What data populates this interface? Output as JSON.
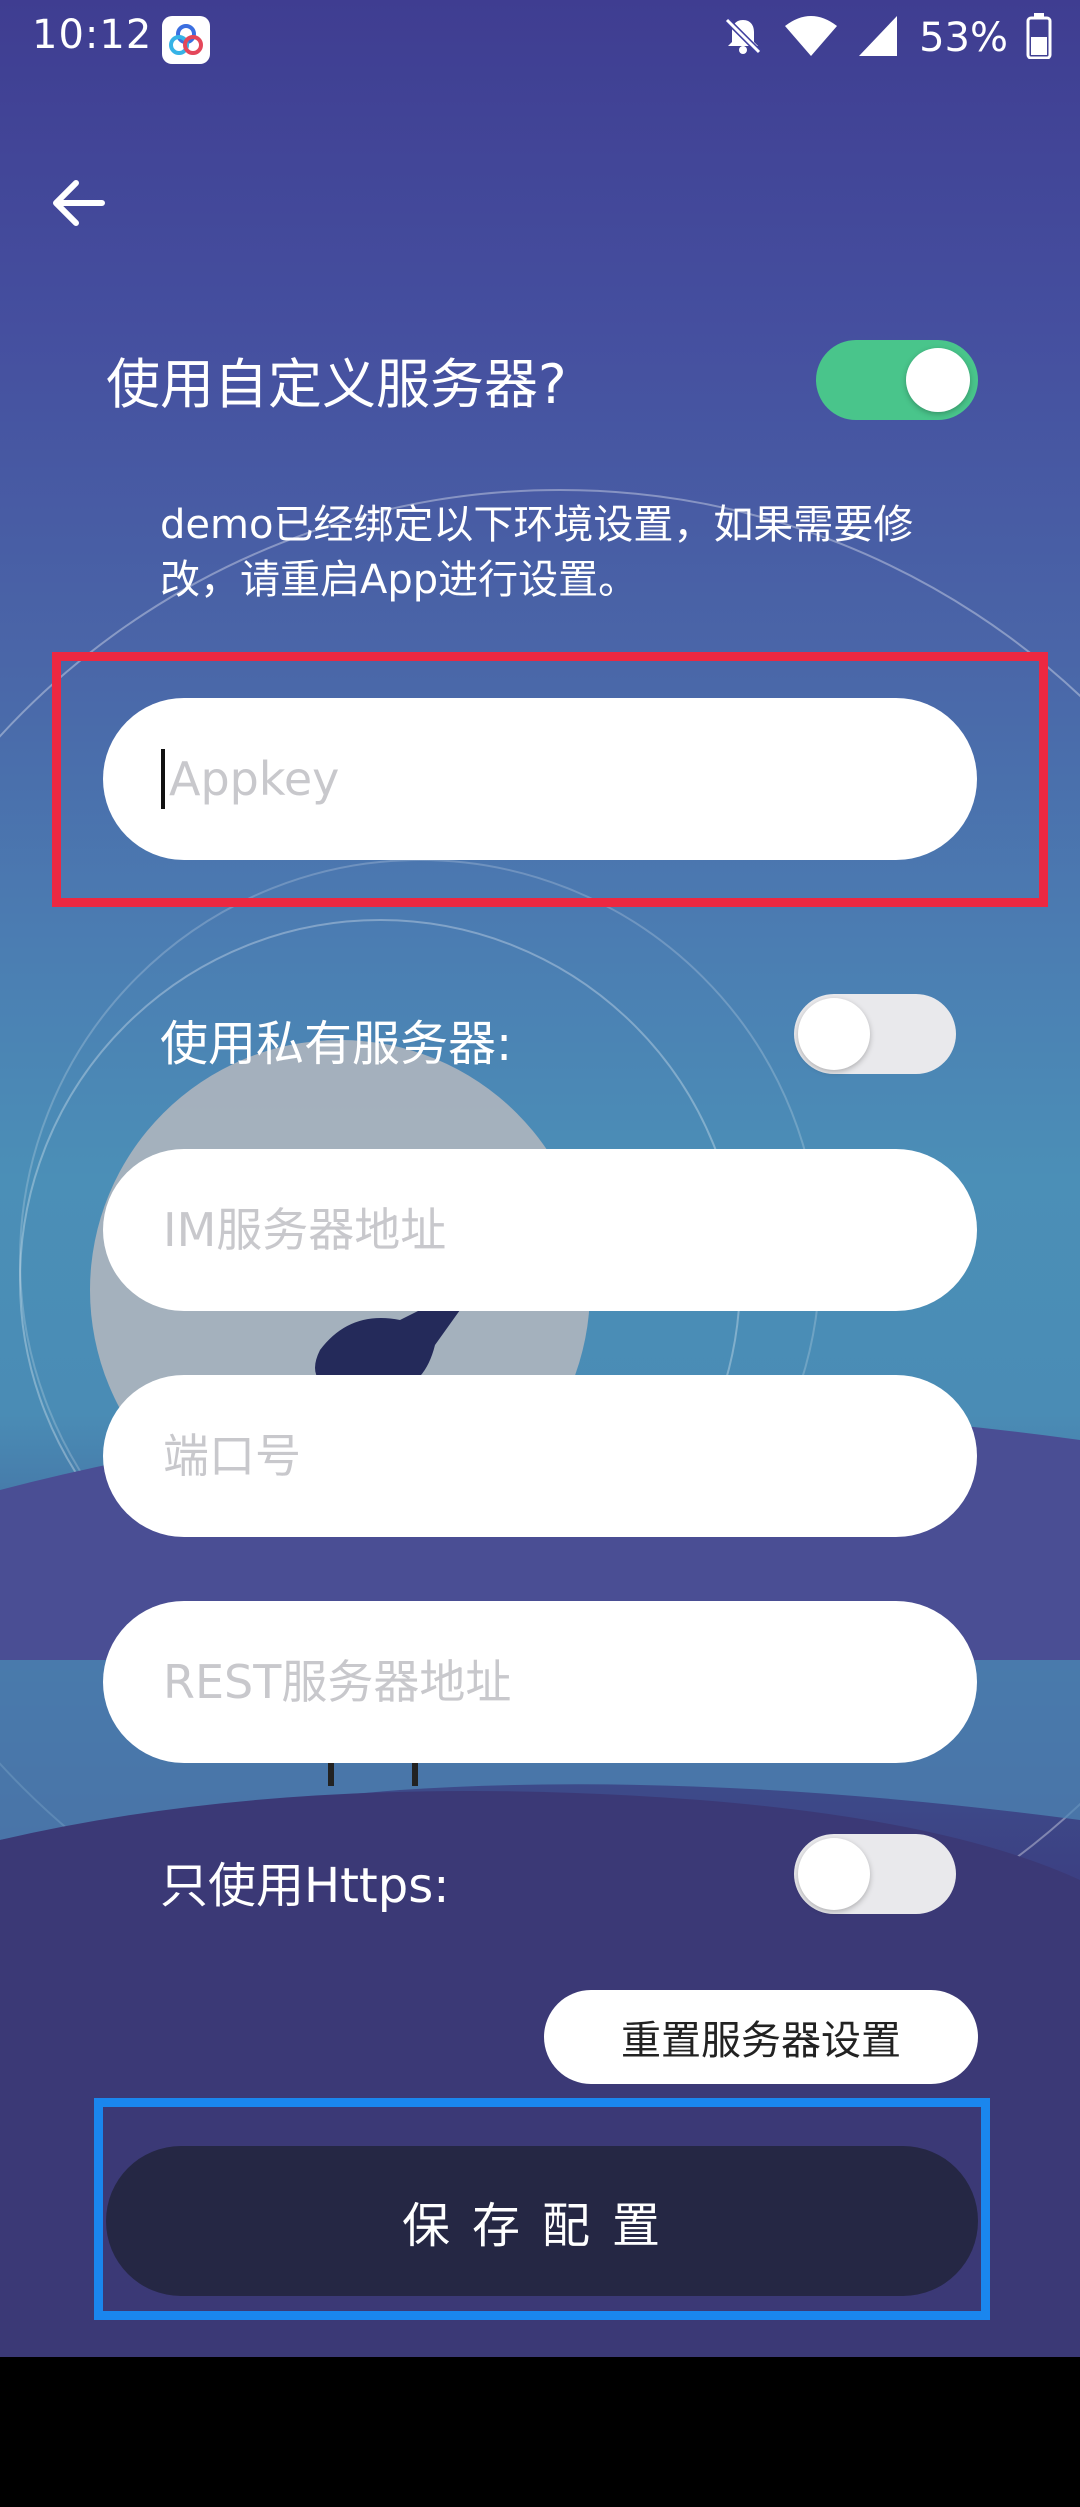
{
  "status_bar": {
    "time": "10:12",
    "battery": "53%"
  },
  "form": {
    "custom_server_label": "使用自定义服务器?",
    "custom_server_enabled": true,
    "notice": "demo已经绑定以下环境设置，如果需要修改，请重启App进行设置。",
    "appkey_placeholder": "Appkey",
    "private_server_label": "使用私有服务器:",
    "private_server_enabled": false,
    "im_server_placeholder": "IM服务器地址",
    "port_placeholder": "端口号",
    "rest_server_placeholder": "REST服务器地址",
    "https_only_label": "只使用Https:",
    "https_only_enabled": false,
    "reset_button": "重置服务器设置",
    "save_button": "保存配置"
  },
  "colors": {
    "toggle_on": "#49c58b",
    "toggle_off": "#e9e9ec",
    "highlight_red": "#ec2841",
    "highlight_blue": "#1a86ee",
    "save_button_bg": "#252744"
  }
}
